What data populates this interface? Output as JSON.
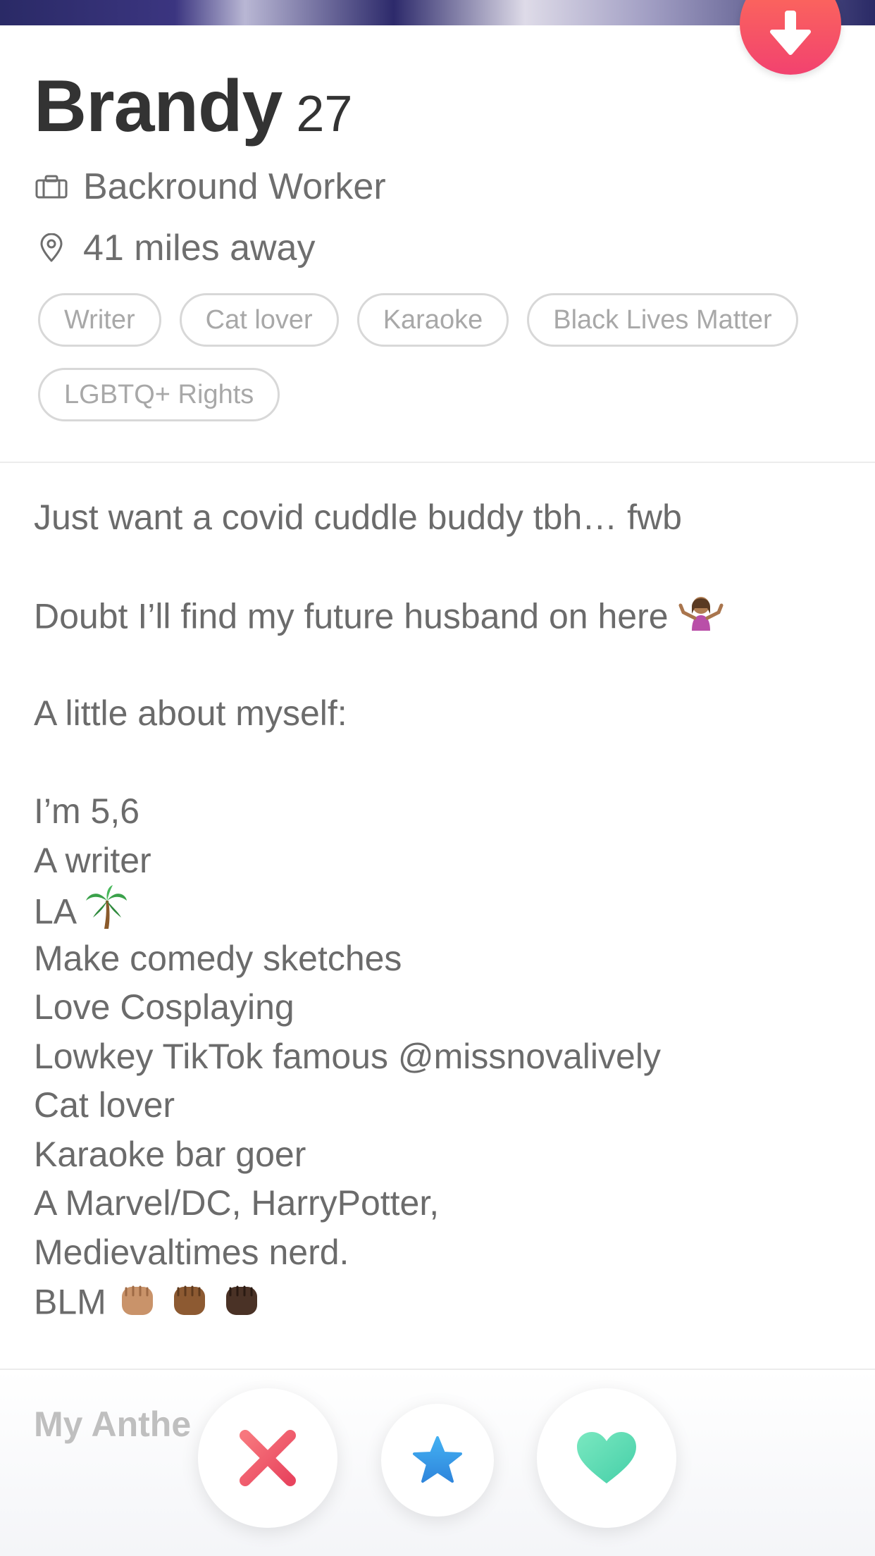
{
  "profile": {
    "name": "Brandy",
    "age": "27",
    "job": "Backround Worker",
    "distance": "41 miles away"
  },
  "interests": [
    "Writer",
    "Cat lover",
    "Karaoke",
    "Black Lives Matter",
    "LGBTQ+ Rights"
  ],
  "bio": {
    "line1": "Just want a covid cuddle buddy tbh… fwb",
    "line2": "Doubt I’ll find my future husband on here",
    "line3": "A little about myself:",
    "line4": "I’m 5,6",
    "line5": "A writer",
    "line6": "LA",
    "line7": "Make comedy sketches",
    "line8": "Love Cosplaying",
    "line9": "Lowkey TikTok famous @missnovalively",
    "line10": "Cat lover",
    "line11": "Karaoke bar goer",
    "line12": "A Marvel/DC, HarryPotter,",
    "line13": "Medievaltimes nerd.",
    "line14": "BLM"
  },
  "section": {
    "anthem_heading": "My Anthe"
  },
  "icons": {
    "collapse": "arrow-down-icon",
    "job": "briefcase-icon",
    "location": "location-pin-icon",
    "nope": "close-x-icon",
    "super_like": "star-icon",
    "like": "heart-icon",
    "shrug": "person-shrugging-emoji",
    "palm": "palm-tree-emoji",
    "fist": "raised-fist-emoji"
  },
  "colors": {
    "accent": "#f2426f",
    "nope": "#f0566a",
    "super_like": "#3d9ae8",
    "like": "#5fd9b3",
    "text": "#6b6b6b",
    "chip_border": "#d8d8d8"
  }
}
